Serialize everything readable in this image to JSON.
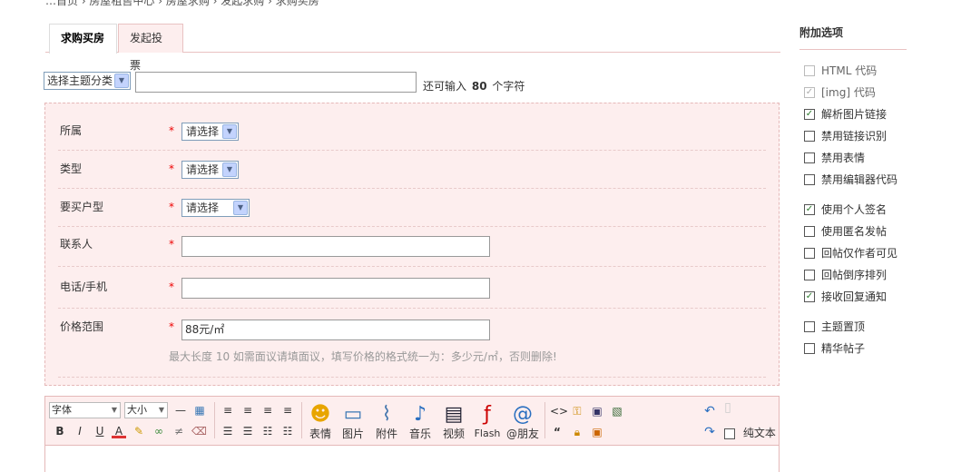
{
  "breadcrumb": "…首页 › 房屋租售中心 › 房屋求购 › 发起求购 › 求购买房",
  "tabs": [
    {
      "label": "求购买房",
      "active": true
    },
    {
      "label": "发起投票",
      "active": false
    }
  ],
  "subject": {
    "category_select": "选择主题分类",
    "remain_prefix": "还可输入",
    "remain_count": "80",
    "remain_suffix": "个字符"
  },
  "form": {
    "rows": [
      {
        "label": "所属",
        "required": "*",
        "select": "请选择"
      },
      {
        "label": "类型",
        "required": "*",
        "select": "请选择"
      },
      {
        "label": "要买户型",
        "required": "*",
        "select": "请选择"
      },
      {
        "label": "联系人",
        "required": "*",
        "value": ""
      },
      {
        "label": "电话/手机",
        "required": "*",
        "value": ""
      },
      {
        "label": "价格范围",
        "required": "*",
        "value": "88元/㎡"
      }
    ],
    "price_hint": "最大长度 10  如需面议请填面议，填写价格的格式统一为：多少元/㎡，否则删除!"
  },
  "editor": {
    "font_select": "字体",
    "size_select": "大小",
    "buttons": {
      "emoticon": "表情",
      "image": "图片",
      "attachment": "附件",
      "music": "音乐",
      "video": "视频",
      "flash": "Flash",
      "friend": "@朋友"
    },
    "plain_text": "纯文本"
  },
  "sidebar": {
    "title": "附加选项",
    "options_group1": [
      {
        "label": "HTML 代码",
        "checked": false,
        "disabled": true
      },
      {
        "label": "[img] 代码",
        "checked": true,
        "disabled": true
      },
      {
        "label": "解析图片链接",
        "checked": true,
        "disabled": false
      },
      {
        "label": "禁用链接识别",
        "checked": false,
        "disabled": false
      },
      {
        "label": "禁用表情",
        "checked": false,
        "disabled": false
      },
      {
        "label": "禁用编辑器代码",
        "checked": false,
        "disabled": false
      }
    ],
    "options_group2": [
      {
        "label": "使用个人签名",
        "checked": true
      },
      {
        "label": "使用匿名发帖",
        "checked": false
      },
      {
        "label": "回帖仅作者可见",
        "checked": false
      },
      {
        "label": "回帖倒序排列",
        "checked": false
      },
      {
        "label": "接收回复通知",
        "checked": true
      }
    ],
    "options_group3": [
      {
        "label": "主题置顶",
        "checked": false
      },
      {
        "label": "精华帖子",
        "checked": false
      }
    ]
  },
  "colors": {
    "panel_bg": "#fdeeee",
    "border": "#e5b8b8",
    "required": "#ee0000",
    "check_mark": "#2a7a2a"
  }
}
